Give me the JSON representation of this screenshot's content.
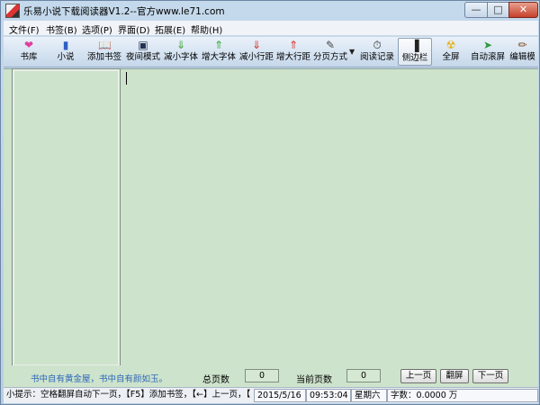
{
  "window": {
    "title": "乐易小说下载阅读器V1.2--官方www.le71.com",
    "min_glyph": "—",
    "max_glyph": "□",
    "close_glyph": "✕"
  },
  "menu": [
    {
      "label": "文件(F)"
    },
    {
      "label": "书签(B)"
    },
    {
      "label": "选项(P)"
    },
    {
      "label": "界面(D)"
    },
    {
      "label": "拓展(E)"
    },
    {
      "label": "帮助(H)"
    }
  ],
  "toolbar": [
    {
      "label": "书库",
      "icon": "bookshelf-icon",
      "glyph": "❤",
      "color": "#e0409a"
    },
    {
      "label": "小说",
      "icon": "book-icon",
      "glyph": "▮",
      "color": "#2d5fc4"
    },
    {
      "label": "添加书签",
      "icon": "add-bookmark-icon",
      "glyph": "📖",
      "color": "#333333"
    },
    {
      "label": "夜间模式",
      "icon": "night-mode-icon",
      "glyph": "▣",
      "color": "#23324f"
    },
    {
      "label": "减小字体",
      "icon": "font-smaller-icon",
      "glyph": "⇓",
      "color": "#3aa635"
    },
    {
      "label": "增大字体",
      "icon": "font-larger-icon",
      "glyph": "⇑",
      "color": "#3aa635"
    },
    {
      "label": "减小行距",
      "icon": "line-smaller-icon",
      "glyph": "⇓",
      "color": "#d6322c"
    },
    {
      "label": "增大行距",
      "icon": "line-larger-icon",
      "glyph": "⇑",
      "color": "#d6322c"
    },
    {
      "label": "分页方式",
      "icon": "paging-icon",
      "glyph": "✎",
      "color": "#444444"
    },
    {
      "label": "阅读记录",
      "icon": "clock-icon",
      "glyph": "⏱",
      "color": "#222222"
    },
    {
      "label": "侧边栏",
      "icon": "sidebar-icon",
      "glyph": "▐",
      "color": "#222222"
    },
    {
      "label": "全屏",
      "icon": "fullscreen-icon",
      "glyph": "☢",
      "color": "#e3b21b"
    },
    {
      "label": "自动滚屏",
      "icon": "auto-scroll-icon",
      "glyph": "➤",
      "color": "#2e9a3a"
    },
    {
      "label": "编辑模",
      "icon": "edit-icon",
      "glyph": "✏",
      "color": "#7a4a22"
    }
  ],
  "info": {
    "motto": "书中自有黄金屋，书中自有颜如玉。",
    "total_pages_label": "总页数",
    "total_pages": "0",
    "current_page_label": "当前页数",
    "current_page": "0",
    "prev_label": "上一页",
    "flip_label": "翻屏",
    "next_label": "下一页"
  },
  "status": {
    "tip": "小提示：空格翻屏自动下一页，【F5】添加书签，【←】上一页，【",
    "date": "2015/5/16",
    "time": "09:53:04",
    "weekday": "星期六",
    "word_count": "字数：0.0000 万"
  }
}
